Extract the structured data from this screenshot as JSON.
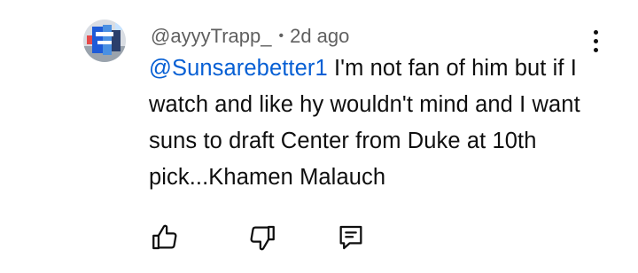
{
  "comment": {
    "author": "@ayyyTrapp_",
    "separator": "•",
    "time": "2d ago",
    "mention": "@Sunsarebetter1",
    "text": " I'm not fan of him but if I watch and like hy wouldn't mind and I want suns to draft Center from Duke at 10th pick...Khamen Malauch"
  },
  "actions": {
    "like_icon": "thumbs-up-icon",
    "dislike_icon": "thumbs-down-icon",
    "reply_icon": "reply-comment-icon",
    "menu_icon": "more-vertical-icon"
  },
  "colors": {
    "mention": "#065fd4",
    "meta": "#606060",
    "text": "#0f0f0f"
  }
}
